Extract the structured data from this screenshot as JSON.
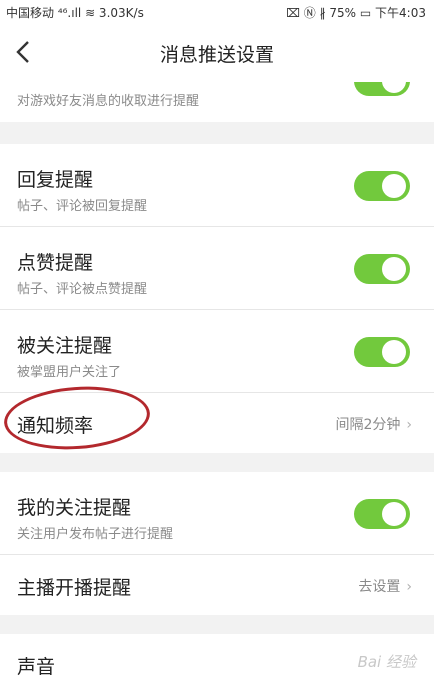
{
  "status_bar": {
    "left": "中国移动 ⁴⁶.ıll ≋ 3.03K/s",
    "right": "⌧ Ⓝ ∦ 75% ▭ 下午4:03"
  },
  "header": {
    "title": "消息推送设置"
  },
  "top_partial": {
    "subtitle": "对游戏好友消息的收取进行提醒",
    "toggle_on": true
  },
  "group1": [
    {
      "title": "回复提醒",
      "subtitle": "帖子、评论被回复提醒",
      "toggle_on": true
    },
    {
      "title": "点赞提醒",
      "subtitle": "帖子、评论被点赞提醒",
      "toggle_on": true
    },
    {
      "title": "被关注提醒",
      "subtitle": "被掌盟用户关注了",
      "toggle_on": true
    }
  ],
  "frequency": {
    "title": "通知频率",
    "value": "间隔2分钟",
    "chevron": "›"
  },
  "group2": [
    {
      "title": "我的关注提醒",
      "subtitle": "关注用户发布帖子进行提醒",
      "toggle_on": true
    }
  ],
  "broadcast": {
    "title": "主播开播提醒",
    "value": "去设置",
    "chevron": "›"
  },
  "sound": {
    "title": "声音"
  },
  "watermark": "Bai 经验",
  "colors": {
    "toggle_on": "#72c93d",
    "annotation": "#b3282d"
  }
}
